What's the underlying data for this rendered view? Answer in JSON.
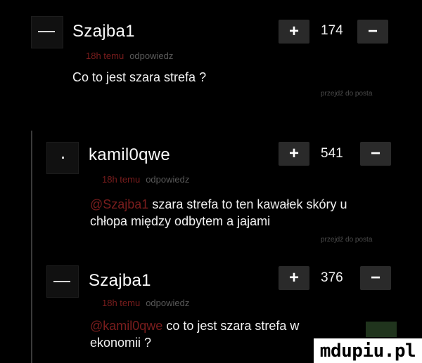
{
  "comments": [
    {
      "username": "Szajba1",
      "score": "174",
      "time": "18h temu",
      "reply": "odpowiedz",
      "mention": "",
      "text": "Co to jest szara strefa ?",
      "goto": "przejdź do posta"
    },
    {
      "username": "kamil0qwe",
      "score": "541",
      "time": "18h temu",
      "reply": "odpowiedz",
      "mention": "@Szajba1",
      "text": "szara strefa to ten kawałek skóry u",
      "text2": "chłopa między odbytem a jajami",
      "goto": "przejdź do posta"
    },
    {
      "username": "Szajba1",
      "score": "376",
      "time": "18h temu",
      "reply": "odpowiedz",
      "mention": "@kamil0qwe",
      "text": "co to jest szara strefa w",
      "text2": "ekonomii ?"
    }
  ],
  "controls": {
    "plus": "+",
    "minus": "−"
  },
  "watermark": "mdupiu.pl",
  "colors": {
    "background": "#000000",
    "mention": "#7a1d1d",
    "meta": "#5a5a5a",
    "button": "#2a2a2a"
  }
}
